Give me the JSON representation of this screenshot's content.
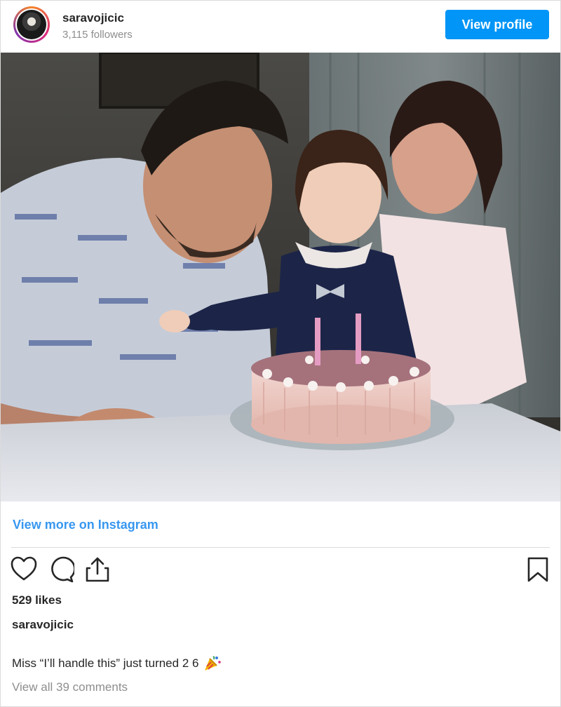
{
  "header": {
    "username": "saravojicic",
    "followers": "3,115 followers",
    "view_profile_label": "View profile"
  },
  "post": {
    "view_more_label": "View more on Instagram",
    "likes": "529 likes",
    "caption_username": "saravojicic",
    "caption_text": "Miss “I’ll handle this” just turned 2 6",
    "caption_emoji_icon": "party-popper-icon",
    "view_comments_label": "View all 39 comments"
  },
  "actions": {
    "like_icon": "heart-icon",
    "comment_icon": "comment-icon",
    "share_icon": "share-icon",
    "save_icon": "bookmark-icon"
  },
  "colors": {
    "accent": "#0095f6",
    "link": "#3897f0",
    "muted": "#8e8e8e"
  }
}
